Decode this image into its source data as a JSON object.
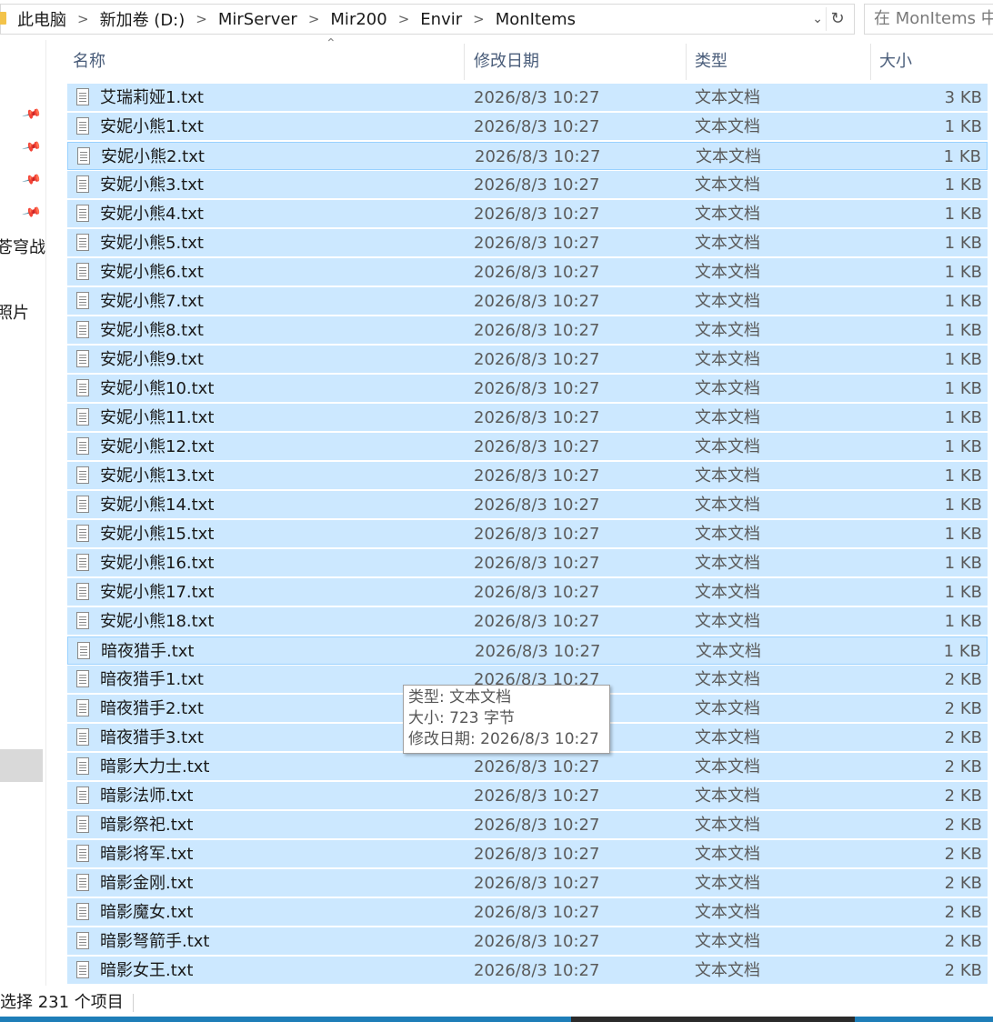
{
  "address": {
    "crumbs": [
      "此电脑",
      "新加卷 (D:)",
      "MirServer",
      "Mir200",
      "Envir",
      "MonItems"
    ],
    "separator": ">",
    "dropdown_glyph": "⌄",
    "refresh_glyph": "↻"
  },
  "search": {
    "placeholder": "在 MonItems 中"
  },
  "nav": {
    "pin_icons": [
      "pin-icon",
      "pin-icon",
      "pin-icon",
      "pin-icon"
    ],
    "pin_glyph": "📌",
    "items": [
      "苍穹战",
      "照片"
    ]
  },
  "columns": {
    "name": "名称",
    "date": "修改日期",
    "type": "类型",
    "size": "大小",
    "sort_glyph": "⌃"
  },
  "files": [
    {
      "name": "艾瑞莉娅1.txt",
      "date": "2026/8/3 10:27",
      "type": "文本文档",
      "size": "3 KB"
    },
    {
      "name": "安妮小熊1.txt",
      "date": "2026/8/3 10:27",
      "type": "文本文档",
      "size": "1 KB"
    },
    {
      "name": "安妮小熊2.txt",
      "date": "2026/8/3 10:27",
      "type": "文本文档",
      "size": "1 KB"
    },
    {
      "name": "安妮小熊3.txt",
      "date": "2026/8/3 10:27",
      "type": "文本文档",
      "size": "1 KB"
    },
    {
      "name": "安妮小熊4.txt",
      "date": "2026/8/3 10:27",
      "type": "文本文档",
      "size": "1 KB"
    },
    {
      "name": "安妮小熊5.txt",
      "date": "2026/8/3 10:27",
      "type": "文本文档",
      "size": "1 KB"
    },
    {
      "name": "安妮小熊6.txt",
      "date": "2026/8/3 10:27",
      "type": "文本文档",
      "size": "1 KB"
    },
    {
      "name": "安妮小熊7.txt",
      "date": "2026/8/3 10:27",
      "type": "文本文档",
      "size": "1 KB"
    },
    {
      "name": "安妮小熊8.txt",
      "date": "2026/8/3 10:27",
      "type": "文本文档",
      "size": "1 KB"
    },
    {
      "name": "安妮小熊9.txt",
      "date": "2026/8/3 10:27",
      "type": "文本文档",
      "size": "1 KB"
    },
    {
      "name": "安妮小熊10.txt",
      "date": "2026/8/3 10:27",
      "type": "文本文档",
      "size": "1 KB"
    },
    {
      "name": "安妮小熊11.txt",
      "date": "2026/8/3 10:27",
      "type": "文本文档",
      "size": "1 KB"
    },
    {
      "name": "安妮小熊12.txt",
      "date": "2026/8/3 10:27",
      "type": "文本文档",
      "size": "1 KB"
    },
    {
      "name": "安妮小熊13.txt",
      "date": "2026/8/3 10:27",
      "type": "文本文档",
      "size": "1 KB"
    },
    {
      "name": "安妮小熊14.txt",
      "date": "2026/8/3 10:27",
      "type": "文本文档",
      "size": "1 KB"
    },
    {
      "name": "安妮小熊15.txt",
      "date": "2026/8/3 10:27",
      "type": "文本文档",
      "size": "1 KB"
    },
    {
      "name": "安妮小熊16.txt",
      "date": "2026/8/3 10:27",
      "type": "文本文档",
      "size": "1 KB"
    },
    {
      "name": "安妮小熊17.txt",
      "date": "2026/8/3 10:27",
      "type": "文本文档",
      "size": "1 KB"
    },
    {
      "name": "安妮小熊18.txt",
      "date": "2026/8/3 10:27",
      "type": "文本文档",
      "size": "1 KB"
    },
    {
      "name": "暗夜猎手.txt",
      "date": "2026/8/3 10:27",
      "type": "文本文档",
      "size": "1 KB"
    },
    {
      "name": "暗夜猎手1.txt",
      "date": "2026/8/3 10:27",
      "type": "文本文档",
      "size": "2 KB"
    },
    {
      "name": "暗夜猎手2.txt",
      "date": "2026/8/3 10:27",
      "type": "文本文档",
      "size": "2 KB"
    },
    {
      "name": "暗夜猎手3.txt",
      "date": "2026/8/3 10:27",
      "type": "文本文档",
      "size": "2 KB"
    },
    {
      "name": "暗影大力士.txt",
      "date": "2026/8/3 10:27",
      "type": "文本文档",
      "size": "2 KB"
    },
    {
      "name": "暗影法师.txt",
      "date": "2026/8/3 10:27",
      "type": "文本文档",
      "size": "2 KB"
    },
    {
      "name": "暗影祭祀.txt",
      "date": "2026/8/3 10:27",
      "type": "文本文档",
      "size": "2 KB"
    },
    {
      "name": "暗影将军.txt",
      "date": "2026/8/3 10:27",
      "type": "文本文档",
      "size": "2 KB"
    },
    {
      "name": "暗影金刚.txt",
      "date": "2026/8/3 10:27",
      "type": "文本文档",
      "size": "2 KB"
    },
    {
      "name": "暗影魔女.txt",
      "date": "2026/8/3 10:27",
      "type": "文本文档",
      "size": "2 KB"
    },
    {
      "name": "暗影弩箭手.txt",
      "date": "2026/8/3 10:27",
      "type": "文本文档",
      "size": "2 KB"
    },
    {
      "name": "暗影女王.txt",
      "date": "2026/8/3 10:27",
      "type": "文本文档",
      "size": "2 KB"
    }
  ],
  "focused_rows": [
    2,
    19
  ],
  "tooltip": {
    "type_line": "类型: 文本文档",
    "size_line": "大小: 723 字节",
    "date_line": "修改日期: 2026/8/3 10:27"
  },
  "status": {
    "text": "选择 231 个项目"
  },
  "colors": {
    "selection": "#cce8ff",
    "focus_border": "#99d1ff",
    "header_text": "#4a5d7a"
  }
}
